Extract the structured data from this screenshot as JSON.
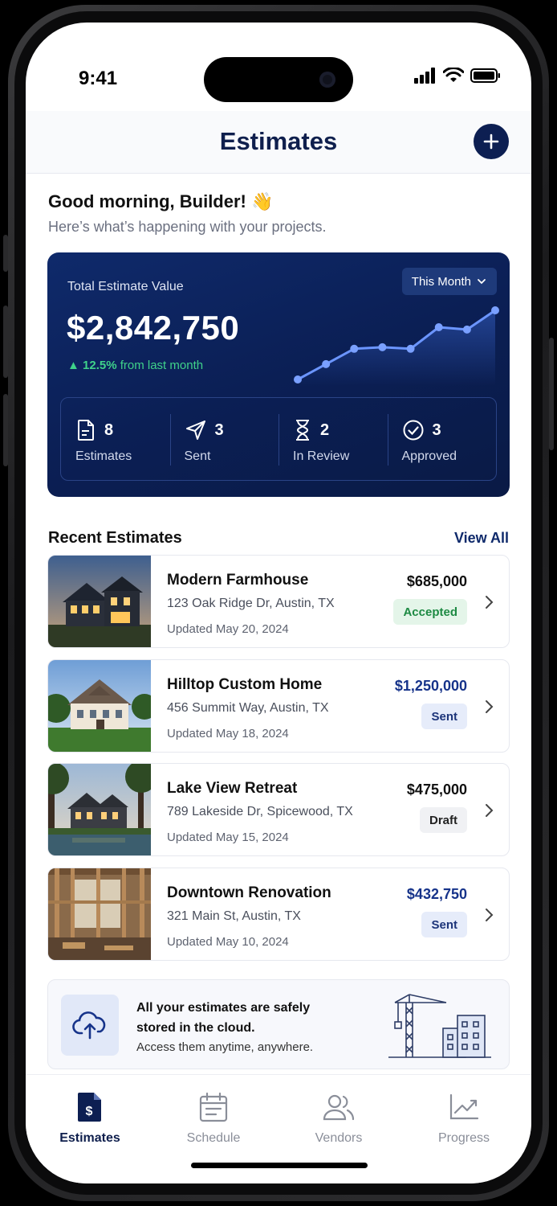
{
  "status_bar": {
    "time": "9:41"
  },
  "header": {
    "title": "Estimates",
    "add_icon": "plus-icon"
  },
  "greeting": {
    "title": "Good morning, Builder! 👋",
    "subtitle": "Here’s what’s happening with your projects."
  },
  "summary": {
    "label": "Total Estimate Value",
    "value": "$2,842,750",
    "change_pct": "▲ 12.5%",
    "change_text": " from last month",
    "period": "This Month",
    "trend_values": [
      1,
      3,
      5,
      5.2,
      5,
      7.8,
      7.5,
      10
    ],
    "stats": [
      {
        "icon": "document-icon",
        "count": "8",
        "label": "Estimates"
      },
      {
        "icon": "send-icon",
        "count": "3",
        "label": "Sent"
      },
      {
        "icon": "hourglass-icon",
        "count": "2",
        "label": "In Review"
      },
      {
        "icon": "check-circle-icon",
        "count": "3",
        "label": "Approved"
      }
    ]
  },
  "recent": {
    "title": "Recent Estimates",
    "view_all": "View All",
    "items": [
      {
        "name": "Modern Farmhouse",
        "address": "123 Oak Ridge Dr, Austin, TX",
        "updated": "Updated May 20, 2024",
        "amount": "$685,000",
        "status": "Accepted"
      },
      {
        "name": "Hilltop Custom Home",
        "address": "456 Summit Way, Austin, TX",
        "updated": "Updated May 18, 2024",
        "amount": "$1,250,000",
        "status": "Sent"
      },
      {
        "name": "Lake View Retreat",
        "address": "789 Lakeside Dr, Spicewood, TX",
        "updated": "Updated May 15, 2024",
        "amount": "$475,000",
        "status": "Draft"
      },
      {
        "name": "Downtown Renovation",
        "address": "321 Main St, Austin, TX",
        "updated": "Updated May 10, 2024",
        "amount": "$432,750",
        "status": "Sent"
      }
    ]
  },
  "cloud_banner": {
    "title": "All your estimates are safely stored in the cloud.",
    "subtitle": "Access them anytime, anywhere.",
    "icon": "cloud-upload-icon"
  },
  "tabs": [
    {
      "label": "Estimates",
      "icon": "invoice-dollar-icon",
      "active": true
    },
    {
      "label": "Schedule",
      "icon": "calendar-icon",
      "active": false
    },
    {
      "label": "Vendors",
      "icon": "users-icon",
      "active": false
    },
    {
      "label": "Progress",
      "icon": "trend-chart-icon",
      "active": false
    }
  ],
  "colors": {
    "navy": "#0b1f55",
    "accent_green": "#3fd28a",
    "badge_blue": "#e6ecfa"
  }
}
